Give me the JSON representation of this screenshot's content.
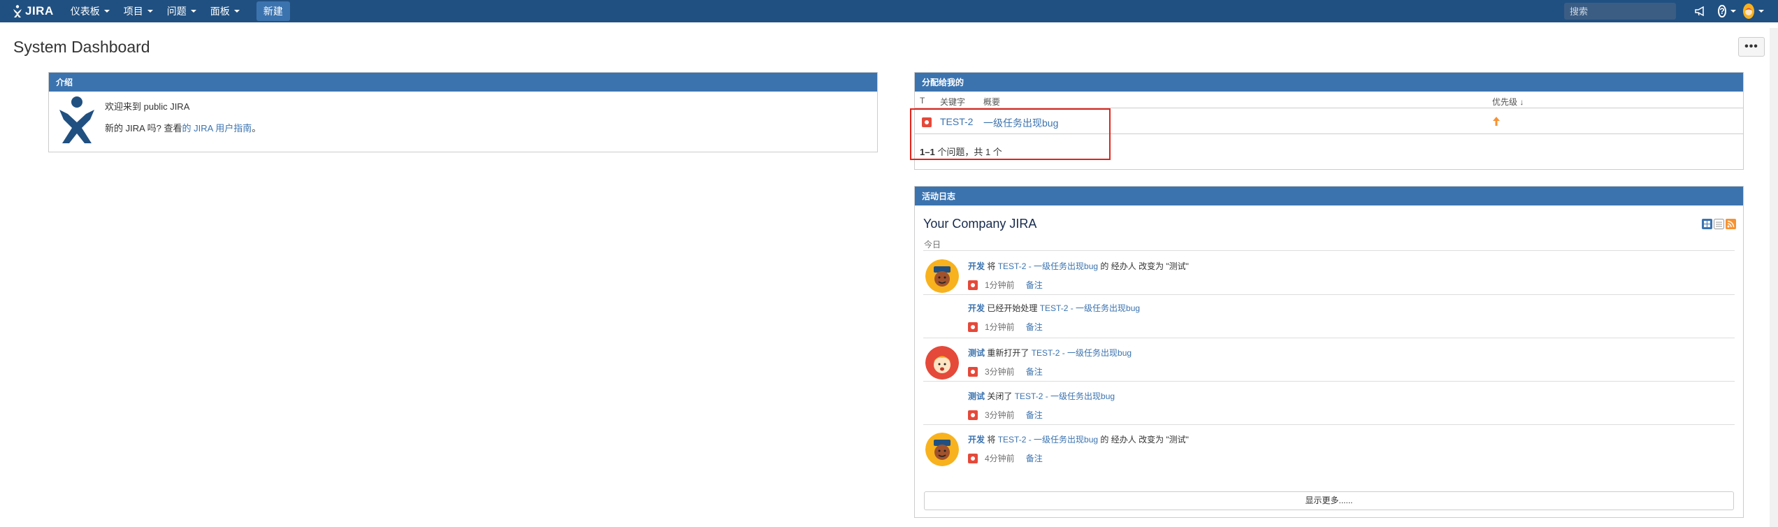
{
  "header": {
    "logo_text": "JIRA",
    "nav": [
      {
        "label": "仪表板"
      },
      {
        "label": "项目"
      },
      {
        "label": "问题"
      },
      {
        "label": "面板"
      }
    ],
    "create_label": "新建",
    "search_placeholder": "搜索"
  },
  "page": {
    "title": "System Dashboard",
    "more_label": "•••"
  },
  "intro": {
    "header": "介绍",
    "line1": "欢迎来到 public JIRA",
    "line2_prefix": "新的 JIRA 吗? 查看",
    "line2_link": "的 JIRA 用户指南",
    "line2_suffix": "。"
  },
  "assigned": {
    "header": "分配给我的",
    "columns": {
      "type": "T",
      "key": "关键字",
      "summary": "概要",
      "priority": "优先级"
    },
    "rows": [
      {
        "key": "TEST-2",
        "summary": "一级任务出现bug"
      }
    ],
    "footer_count": "1–1",
    "footer_text": "个问题，共 1 个"
  },
  "activity": {
    "header": "活动日志",
    "title": "Your Company JIRA",
    "section": "今日",
    "entries": [
      {
        "actor": "开发",
        "pre": " 将 ",
        "issue": "TEST-2 - 一级任务出现bug",
        "post": " 的 经办人 改变为 \"测试\"",
        "time": "1分钟前",
        "comment": "备注",
        "avatar": "dev"
      },
      {
        "actor": "开发",
        "pre": " 已经开始处理 ",
        "issue": "TEST-2 - 一级任务出现bug",
        "post": "",
        "time": "1分钟前",
        "comment": "备注",
        "avatar": ""
      },
      {
        "actor": "测试",
        "pre": " 重新打开了 ",
        "issue": "TEST-2 - 一级任务出现bug",
        "post": "",
        "time": "3分钟前",
        "comment": "备注",
        "avatar": "test"
      },
      {
        "actor": "测试",
        "pre": " 关闭了 ",
        "issue": "TEST-2 - 一级任务出现bug",
        "post": "",
        "time": "3分钟前",
        "comment": "备注",
        "avatar": ""
      },
      {
        "actor": "开发",
        "pre": " 将 ",
        "issue": "TEST-2 - 一级任务出现bug",
        "post": " 的 经办人 改变为 \"测试\"",
        "time": "4分钟前",
        "comment": "备注",
        "avatar": "dev"
      }
    ],
    "show_more": "显示更多......"
  },
  "colors": {
    "header_bg": "#205081",
    "gadget_header": "#3b73af",
    "link": "#3b73af",
    "highlight_box": "#e2231a",
    "priority": "#f79232"
  }
}
